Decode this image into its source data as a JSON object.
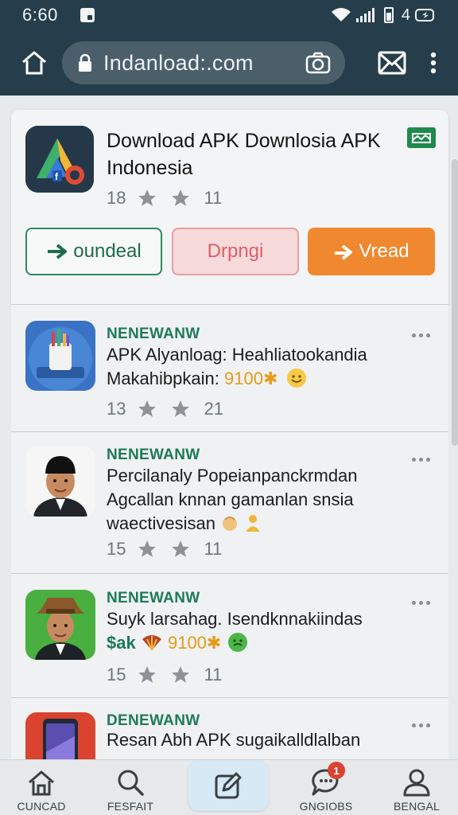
{
  "status_bar": {
    "time": "6:60",
    "battery_text": "4"
  },
  "browser": {
    "url": "Indanload:.com"
  },
  "hero": {
    "title": "Download APK Downlosia APK Indonesia",
    "meta_a": "18",
    "meta_b": "11",
    "buttons": {
      "download": "oundeal",
      "dropdown": "Drpngi",
      "read": "Vread"
    }
  },
  "items": [
    {
      "tag": "NENEWANW",
      "line1": "APK Alyanloag: Heahliatookandia",
      "line2_text": "Makahibpkain: ",
      "line2_hl": "9100",
      "line3": "",
      "meta_a": "13",
      "meta_b": "21"
    },
    {
      "tag": "NENEWANW",
      "line1": "Percilanaly Popeianpanckrmdan",
      "line2_text": "Agcallan knnan gamanlan snsia",
      "line2_hl": "",
      "line3": "waectivesisan",
      "meta_a": "15",
      "meta_b": "11"
    },
    {
      "tag": "NENEWANW",
      "line1": "Suyk larsahag. Isendknnakiindas",
      "line2_text": "$ak",
      "line2_hl": "9100",
      "line3": "",
      "meta_a": "15",
      "meta_b": "11"
    },
    {
      "tag": "DENEWANW",
      "line1": "Resan Abh APK sugaikalldlalban",
      "line2_text": "",
      "line2_hl": "",
      "line3": "",
      "meta_a": "",
      "meta_b": ""
    }
  ],
  "bottom_nav": {
    "items": [
      {
        "label": "CUNCAD",
        "icon": "home-icon"
      },
      {
        "label": "FESFAIT",
        "icon": "search-icon"
      },
      {
        "label": "",
        "icon": "edit-icon"
      },
      {
        "label": "GNGIOBS",
        "icon": "chat-icon",
        "badge": "1"
      },
      {
        "label": "BENGAL",
        "icon": "user-icon"
      }
    ]
  },
  "colors": {
    "toolbar": "#263e4b",
    "accent_green": "#1e7a56",
    "accent_orange": "#f0882f",
    "accent_red": "#d9606a",
    "badge": "#d9432f"
  }
}
